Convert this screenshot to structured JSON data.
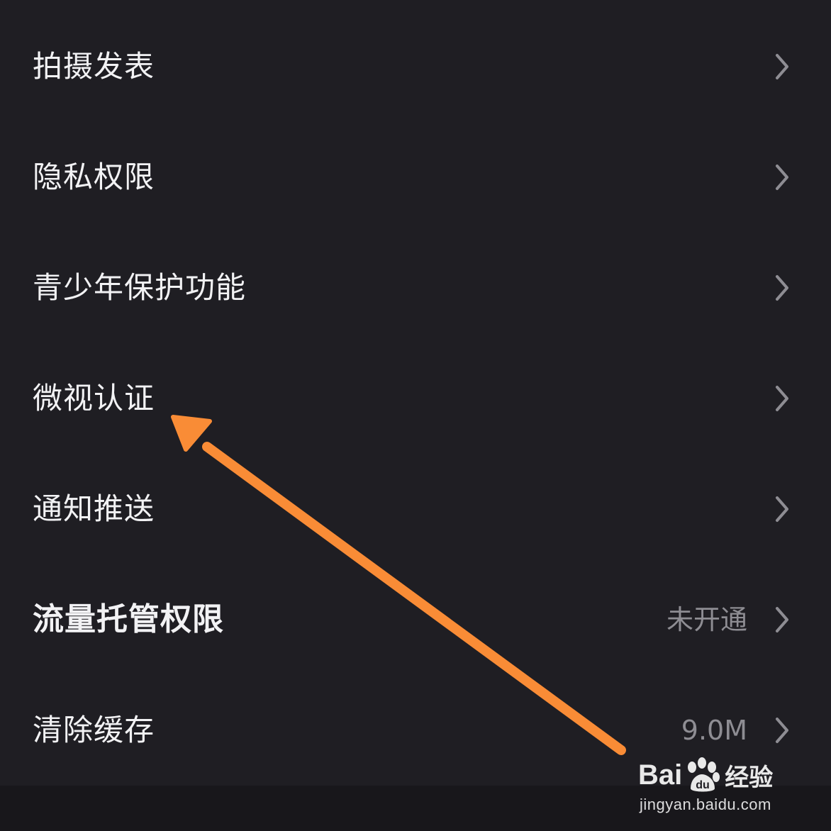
{
  "settings": {
    "items": [
      {
        "label": "拍摄发表",
        "value": ""
      },
      {
        "label": "隐私权限",
        "value": ""
      },
      {
        "label": "青少年保护功能",
        "value": ""
      },
      {
        "label": "微视认证",
        "value": ""
      },
      {
        "label": "通知推送",
        "value": ""
      },
      {
        "label": "流量托管权限",
        "value": "未开通",
        "bold": true
      },
      {
        "label": "清除缓存",
        "value": "9.0M"
      }
    ],
    "chevron_icon": "chevron-right-icon"
  },
  "annotation": {
    "arrow_color": "#f98c36",
    "arrow_icon": "arrow-pointer-icon"
  },
  "watermark": {
    "logo_text_left": "Bai",
    "logo_text_right": "经验",
    "url": "jingyan.baidu.com"
  },
  "colors": {
    "background": "#1f1e23",
    "label": "#f2f2f4",
    "value": "#8e8d93",
    "chevron": "#8e8d93",
    "arrow": "#f98c36"
  }
}
